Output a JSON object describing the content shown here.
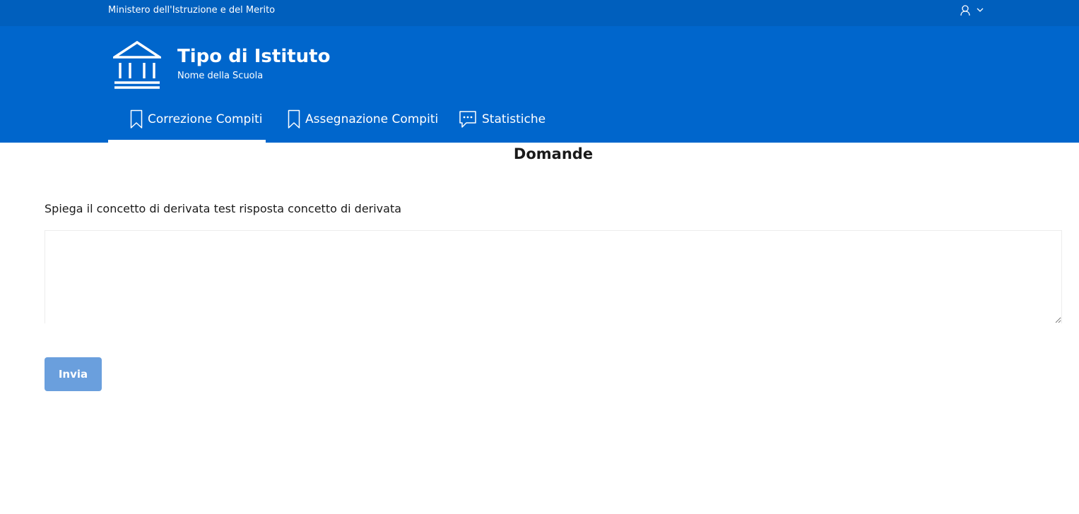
{
  "slim_header": {
    "title": "Ministero dell'Istruzione e del Merito",
    "user_icon": "user-icon",
    "chevron_icon": "chevron-down-icon"
  },
  "brand": {
    "logo_icon": "institution-building-icon",
    "title": "Tipo di Istituto",
    "subtitle": "Nome della Scuola"
  },
  "nav": {
    "items": [
      {
        "label": "Correzione Compiti",
        "icon": "bookmark-icon",
        "active": true
      },
      {
        "label": "Assegnazione Compiti",
        "icon": "bookmark-icon",
        "active": false
      },
      {
        "label": "Statistiche",
        "icon": "chat-bubble-icon",
        "active": false
      }
    ]
  },
  "main": {
    "section_title": "Domande",
    "question": "Spiega il concetto di derivata test risposta concetto di derivata",
    "answer_value": "",
    "submit_label": "Invia"
  },
  "colors": {
    "slim_header_bg": "#005fbd",
    "header_bg": "#0066cc",
    "button_bg": "#6a9fdd",
    "text": "#1a1a1a"
  }
}
